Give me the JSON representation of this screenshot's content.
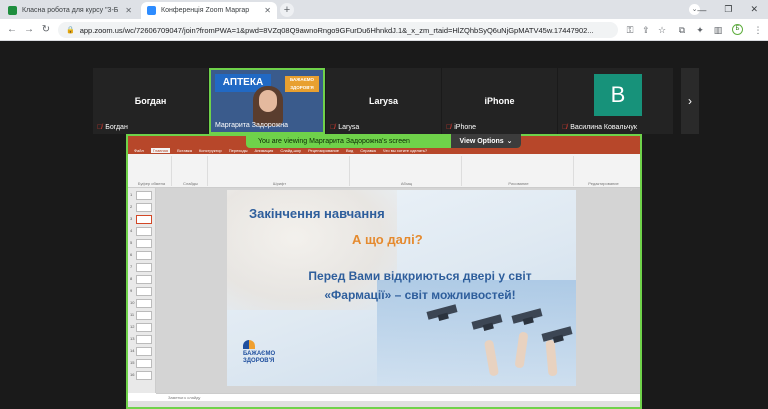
{
  "browser": {
    "tabs": [
      {
        "title": "Класна робота для курсу \"3-Б"
      },
      {
        "title": "Конференція Zoom Маргар"
      }
    ],
    "url": "app.zoom.us/wc/72606709047/join?fromPWA=1&pwd=8VZq08Q9awnoRngo9GFurDu6HhnkdJ.1&_x_zm_rtaid=HlZQhbSyQ6uNjGpMATV45w.17447902...",
    "profile_initial": "Б"
  },
  "participants": [
    {
      "name": "Богдан",
      "label": "Богдан",
      "muted": true
    },
    {
      "name": "Маргарита Задорожна",
      "label": "Маргарита Задорожна",
      "muted": false,
      "speaking": true
    },
    {
      "name": "Larysa",
      "label": "Larysa",
      "muted": true
    },
    {
      "name": "iPhone",
      "label": "iPhone",
      "muted": true
    },
    {
      "name": "B",
      "label": "Василина Ковальчук",
      "muted": true
    }
  ],
  "share": {
    "banner": "You are viewing Маргарита Задорожна's screen",
    "view_options": "View Options"
  },
  "ppt": {
    "tabs": [
      "Файл",
      "Главная",
      "Вставка",
      "Конструктор",
      "Переходы",
      "Анимация",
      "Слайд-шоу",
      "Рецензирование",
      "Вид",
      "Справка",
      "Что вы хотите сделать?"
    ],
    "groups": [
      "Буфер обмена",
      "Слайды",
      "Шрифт",
      "Абзац",
      "Рисование",
      "Редактирование"
    ],
    "notes": "Заметки к слайду",
    "slide_numbers": [
      "1",
      "2",
      "3",
      "4",
      "5",
      "6",
      "7",
      "8",
      "9",
      "10",
      "11",
      "12",
      "13",
      "14",
      "15",
      "16"
    ]
  },
  "slide": {
    "title": "Закінчення навчання",
    "question": "А що далі?",
    "line1": "Перед Вами відкриються двері у світ",
    "line2": "«Фармації» – світ можливостей!",
    "logo_line1": "БАЖАЄМО",
    "logo_line2": "ЗДОРОВ'Я"
  },
  "speaker_tile": {
    "brand": "АПТЕКА",
    "tag": "БАЖАЄМО ЗДОРОВ'Я"
  }
}
